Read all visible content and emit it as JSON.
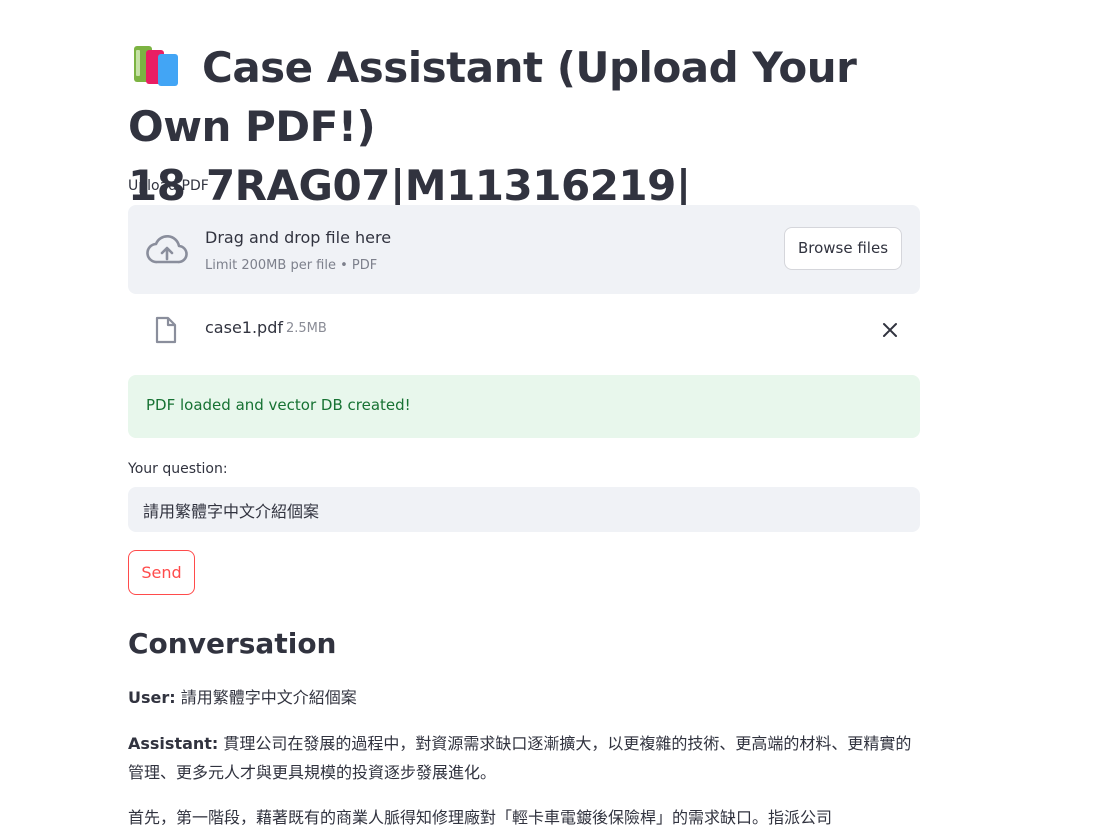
{
  "app": {
    "title": "Case Assistant (Upload Your Own PDF!) 18_7RAG07|M11316219|",
    "title_icon": "books-icon"
  },
  "uploader": {
    "label": "Upload PDF",
    "dropzone_title": "Drag and drop file here",
    "dropzone_subtitle": "Limit 200MB per file • PDF",
    "browse_label": "Browse files",
    "icon": "cloud-upload-icon"
  },
  "uploaded_file": {
    "name": "case1.pdf",
    "size": "2.5MB",
    "icon": "file-icon",
    "remove_icon": "close-icon"
  },
  "status": {
    "message": "PDF loaded and vector DB created!",
    "color": "#177233",
    "background": "#e8f7ec"
  },
  "question": {
    "label": "Your question:",
    "value": "請用繁體字中文介紹個案"
  },
  "send": {
    "label": "Send",
    "color": "#ff4b4b"
  },
  "conversation": {
    "heading": "Conversation",
    "messages": [
      {
        "role_label": "User:",
        "text": "請用繁體字中文介紹個案"
      },
      {
        "role_label": "Assistant:",
        "text": "貫理公司在發展的過程中，對資源需求缺口逐漸擴大，以更複雜的技術、更高端的材料、更精實的管理、更多元人才與更具規模的投資逐步發展進化。"
      }
    ],
    "paragraph": "首先，第一階段，藉著既有的商業人脈得知修理廠對「輕卡車電鍍後保險桿」的需求缺口。指派公司"
  }
}
